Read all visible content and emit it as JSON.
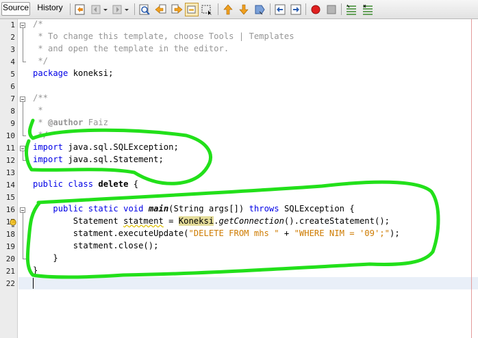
{
  "toolbar": {
    "tabs": [
      {
        "label": "Source",
        "active": true
      },
      {
        "label": "History",
        "active": false
      }
    ],
    "icons": [
      "last-edit-icon",
      "back-icon",
      "dropdown-arrow-icon",
      "forward-icon",
      "dropdown-arrow-icon",
      "find-icon",
      "find-previous-icon",
      "find-next-icon",
      "toggle-highlight-icon",
      "rectangular-selection-icon",
      "previous-bookmark-icon",
      "next-bookmark-icon",
      "toggle-bookmark-icon",
      "shift-left-icon",
      "shift-right-icon",
      "start-macro-icon",
      "stop-macro-icon",
      "comment-icon",
      "uncomment-icon"
    ]
  },
  "editor": {
    "lines": [
      {
        "no": "1",
        "text": "/*"
      },
      {
        "no": "2",
        "text": " * To change this template, choose Tools | Templates"
      },
      {
        "no": "3",
        "text": " * and open the template in the editor."
      },
      {
        "no": "4",
        "text": " */"
      },
      {
        "no": "5",
        "text": "package koneksi;"
      },
      {
        "no": "6",
        "text": ""
      },
      {
        "no": "7",
        "text": "/**"
      },
      {
        "no": "8",
        "text": " *"
      },
      {
        "no": "9",
        "text": " * @author Faiz"
      },
      {
        "no": "10",
        "text": " */"
      },
      {
        "no": "11",
        "text": "import java.sql.SQLException;"
      },
      {
        "no": "12",
        "text": "import java.sql.Statement;"
      },
      {
        "no": "13",
        "text": ""
      },
      {
        "no": "14",
        "text": "public class delete {"
      },
      {
        "no": "15",
        "text": ""
      },
      {
        "no": "16",
        "text": "    public static void main(String args[]) throws SQLException {"
      },
      {
        "no": "17",
        "text": "        Statement statment = Koneksi.getConnection().createStatement();"
      },
      {
        "no": "18",
        "text": "        statment.executeUpdate(\"DELETE FROM mhs \" + \"WHERE NIM = '09';\");"
      },
      {
        "no": "19",
        "text": "        statment.close();"
      },
      {
        "no": "20",
        "text": "    }"
      },
      {
        "no": "21",
        "text": "}"
      },
      {
        "no": "22",
        "text": ""
      }
    ]
  },
  "colors": {
    "keyword": "#0000e6",
    "comment": "#969696",
    "string": "#ce7b00",
    "annotation_stroke": "#22e01a",
    "highlight": "#e4dc9a"
  }
}
